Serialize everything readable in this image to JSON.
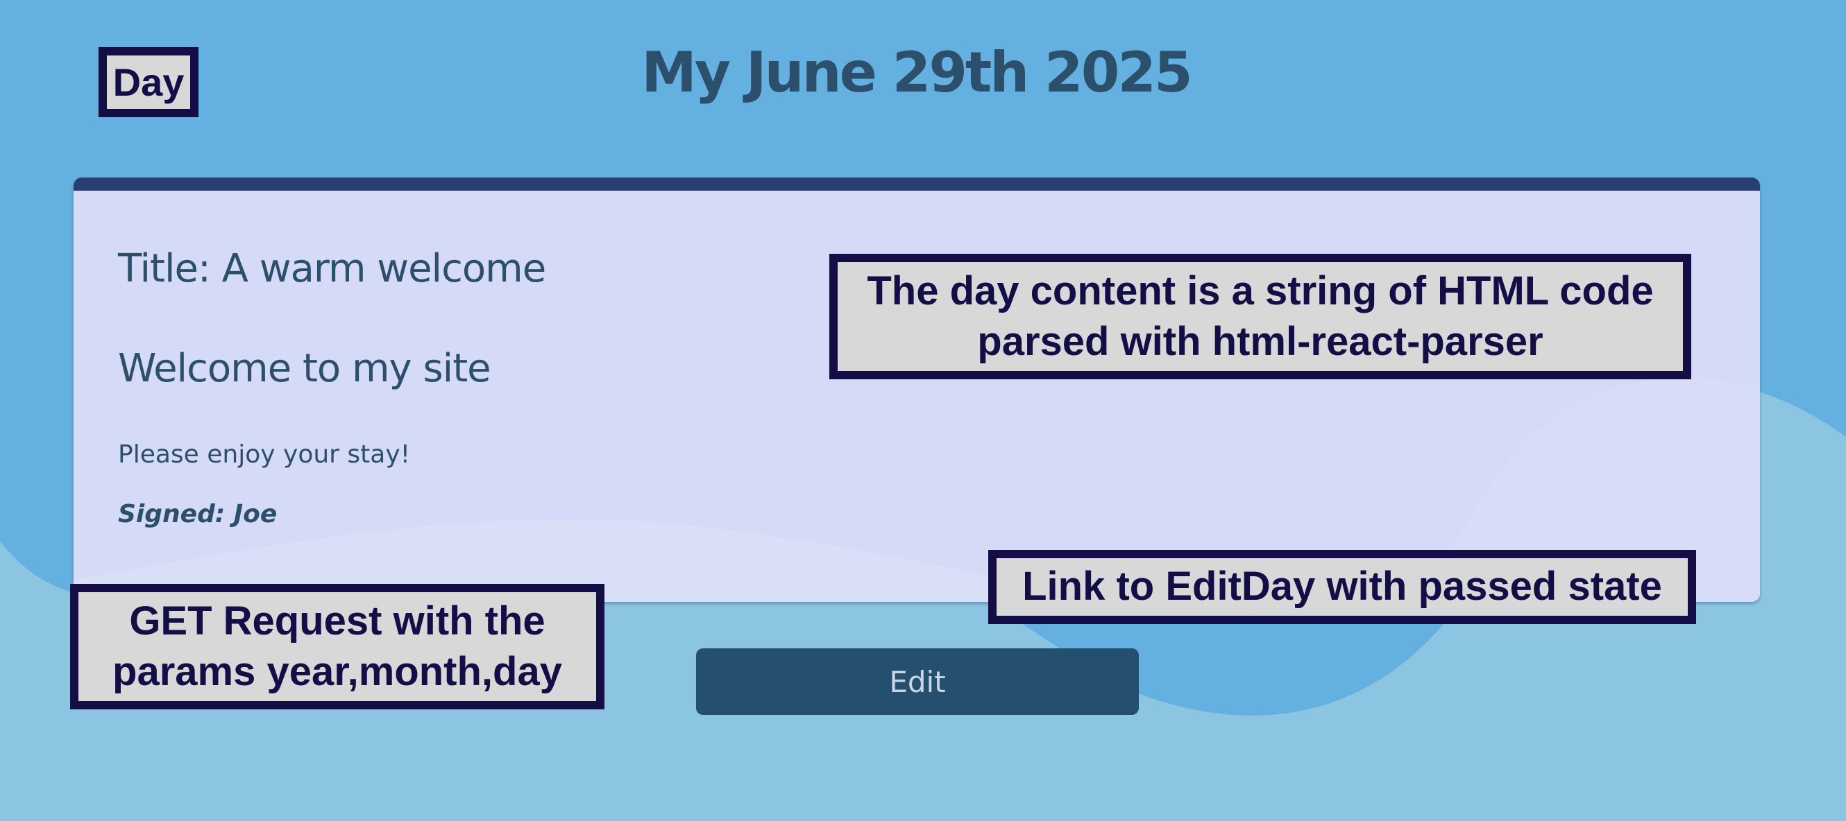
{
  "header": {
    "title": "My June 29th 2025"
  },
  "entry": {
    "title": "Title: A warm welcome",
    "heading": "Welcome to my site",
    "body": "Please enjoy your stay!",
    "signed": "Signed: Joe"
  },
  "actions": {
    "edit_label": "Edit"
  },
  "annotations": {
    "component_label": "Day",
    "content_note": "The day content is a string of HTML code parsed with html-react-parser",
    "link_note": "Link to EditDay with passed state",
    "request_note": "GET Request with the params year,month,day"
  },
  "colors": {
    "page_background": "#64b0e1",
    "wave_background": "#8cc5e1",
    "card_background": "#d5daf6",
    "card_top_border": "#283f74",
    "text": "#2c4f6b",
    "button": "#244f6e",
    "annotation_border": "#130f46",
    "annotation_fill": "#d8d8d8"
  }
}
